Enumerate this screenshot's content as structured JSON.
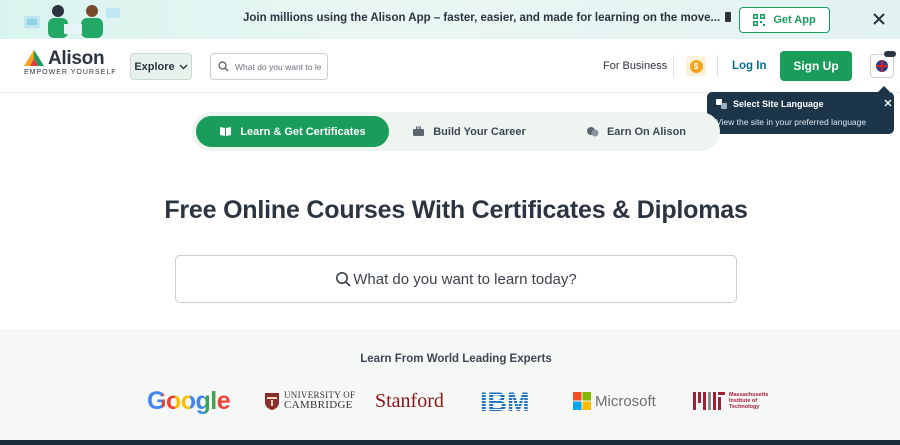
{
  "promo": {
    "text": "Join millions using the Alison App – faster, easier, and made for learning on the move...",
    "get_app_label": "Get App"
  },
  "header": {
    "logo_word": "Alison",
    "logo_tagline": "EMPOWER YOURSELF",
    "explore_label": "Explore",
    "search_placeholder": "What do you want to learn today?",
    "for_business": "For Business",
    "login": "Log In",
    "signup": "Sign Up"
  },
  "lang_tooltip": {
    "title": "Select Site Language",
    "text": "View the site in your preferred language"
  },
  "tabs": [
    {
      "label": "Learn & Get Certificates",
      "active": true
    },
    {
      "label": "Build Your Career",
      "active": false
    },
    {
      "label": "Earn On Alison",
      "active": false
    }
  ],
  "hero": {
    "title": "Free Online Courses With Certificates & Diplomas",
    "search_text": "What do you want to learn today?"
  },
  "experts": {
    "title": "Learn From World Leading Experts",
    "partners": {
      "google": "Google",
      "cambridge_line1": "UNIVERSITY OF",
      "cambridge_line2": "CAMBRIDGE",
      "stanford": "Stanford",
      "ibm": "IBM",
      "microsoft": "Microsoft",
      "mit_line1": "Massachusetts",
      "mit_line2": "Institute of",
      "mit_line3": "Technology"
    }
  },
  "colors": {
    "brand_green": "#1a9c5b",
    "login_blue": "#0a6f8c",
    "tooltip_bg": "#1c3548",
    "coin": "#f4a51c"
  }
}
